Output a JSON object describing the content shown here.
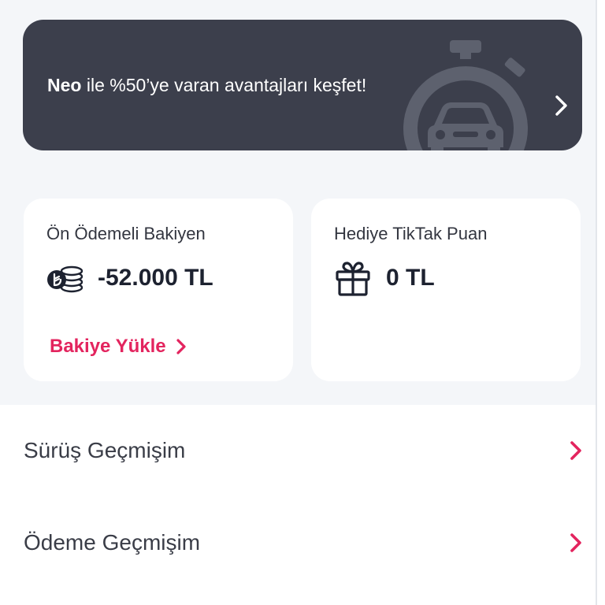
{
  "colors": {
    "banner_bg": "#3c3f4c",
    "accent": "#e3245e",
    "page_bg": "#f4f6f9",
    "text_dark": "#1d2230"
  },
  "promo": {
    "brand": "Neo",
    "text": " ile %50’ye varan avantajları keşfet!",
    "graphic_icon": "stopwatch-car-icon",
    "arrow_icon": "chevron-right-icon"
  },
  "balance_card": {
    "label": "Ön Ödemeli Bakiyen",
    "amount": "-52.000 TL",
    "icon": "coins-icon",
    "action_label": "Bakiye Yükle",
    "action_icon": "chevron-right-icon"
  },
  "points_card": {
    "label": "Hediye TikTak Puan",
    "amount": "0 TL",
    "icon": "gift-icon"
  },
  "menu": {
    "items": [
      {
        "label": "Sürüş Geçmişim",
        "icon": "chevron-right-icon"
      },
      {
        "label": "Ödeme Geçmişim",
        "icon": "chevron-right-icon"
      }
    ]
  }
}
